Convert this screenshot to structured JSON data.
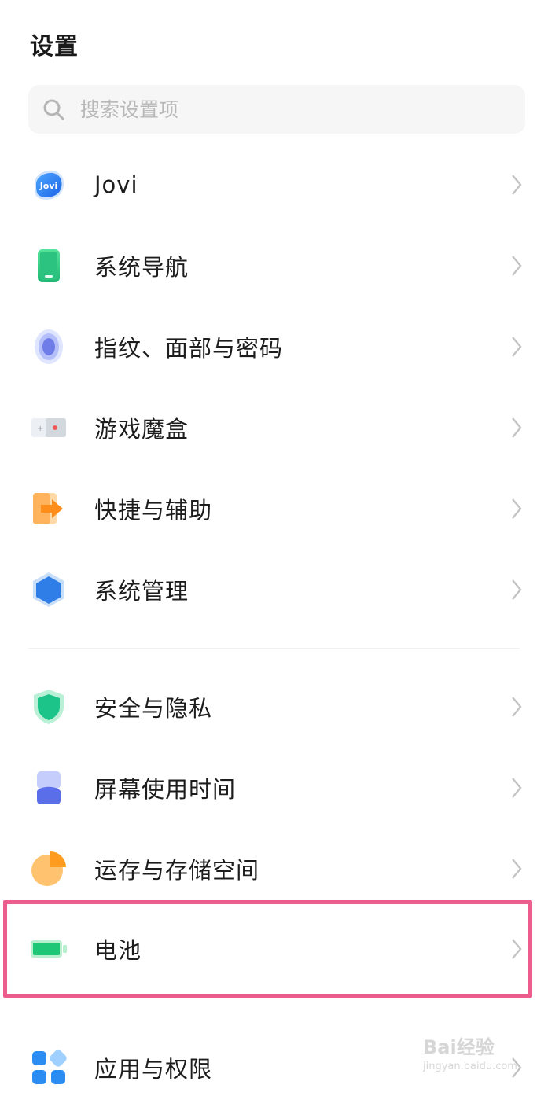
{
  "header": {
    "title": "设置"
  },
  "search": {
    "placeholder": "搜索设置项"
  },
  "items": [
    {
      "label": "Jovi",
      "icon": "jovi-icon"
    },
    {
      "label": "系统导航",
      "icon": "phone-navigation-icon"
    },
    {
      "label": "指纹、面部与密码",
      "icon": "fingerprint-icon"
    },
    {
      "label": "游戏魔盒",
      "icon": "game-box-icon"
    },
    {
      "label": "快捷与辅助",
      "icon": "shortcut-arrow-icon"
    },
    {
      "label": "系统管理",
      "icon": "hexagon-system-icon"
    },
    {
      "label": "安全与隐私",
      "icon": "shield-icon"
    },
    {
      "label": "屏幕使用时间",
      "icon": "hourglass-icon"
    },
    {
      "label": "运存与存储空间",
      "icon": "storage-pie-icon"
    },
    {
      "label": "电池",
      "icon": "battery-icon"
    },
    {
      "label": "应用与权限",
      "icon": "apps-grid-icon"
    }
  ],
  "jovi_icon_text": "Jovi",
  "watermark": {
    "main": "Bai经验",
    "sub": "jingyan.baidu.com"
  },
  "colors": {
    "highlight": "#ec5d8d",
    "chevron": "#c4c4c4"
  }
}
